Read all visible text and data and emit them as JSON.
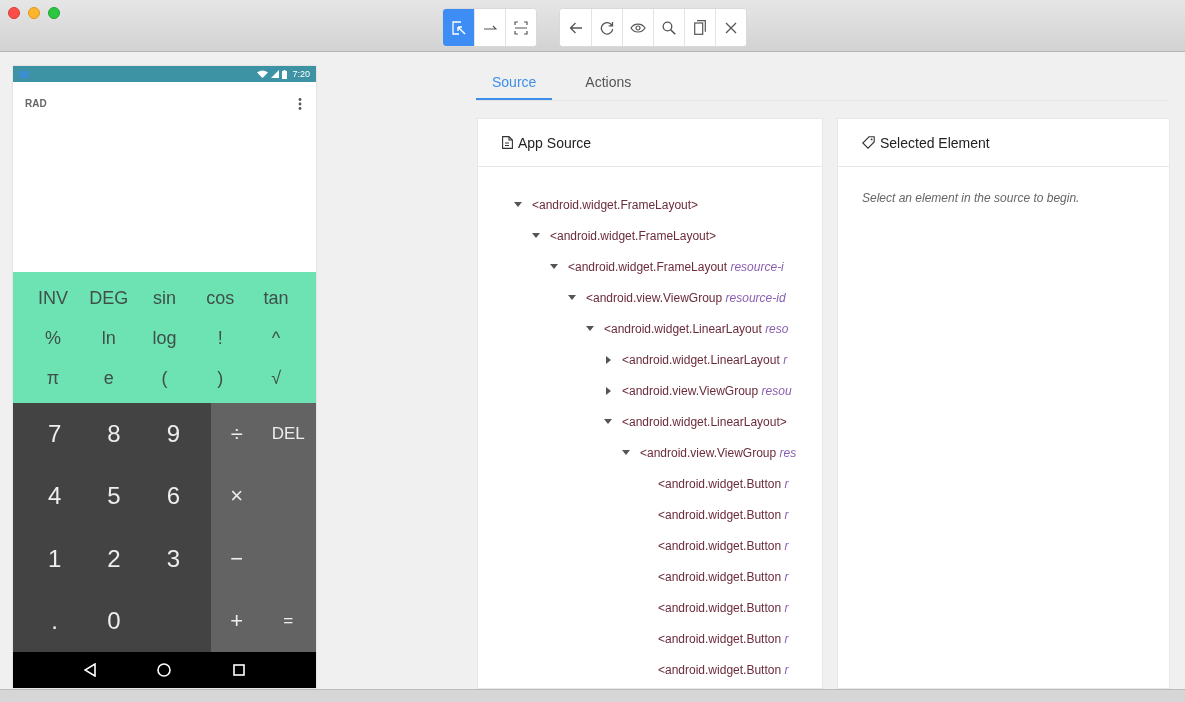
{
  "toolbar": {
    "modes": [
      {
        "kind": "select",
        "selected": true
      },
      {
        "kind": "swipe",
        "selected": false
      },
      {
        "kind": "tap-area",
        "selected": false
      }
    ],
    "actions": [
      {
        "kind": "back"
      },
      {
        "kind": "refresh"
      },
      {
        "kind": "eye"
      },
      {
        "kind": "search"
      },
      {
        "kind": "copy"
      },
      {
        "kind": "close"
      }
    ]
  },
  "device": {
    "status_bar": {
      "time": "7:20"
    },
    "display": {
      "mode": "RAD"
    },
    "advanced_keys": [
      [
        "INV",
        "DEG",
        "sin",
        "cos",
        "tan"
      ],
      [
        "%",
        "ln",
        "log",
        "!",
        "^"
      ],
      [
        "π",
        "e",
        "(",
        ")",
        "√"
      ]
    ],
    "digit_keys": [
      [
        "7",
        "8",
        "9"
      ],
      [
        "4",
        "5",
        "6"
      ],
      [
        "1",
        "2",
        "3"
      ],
      [
        ".",
        "0"
      ]
    ],
    "operator_keys": [
      [
        "÷",
        "DEL"
      ],
      [
        "×"
      ],
      [
        "−"
      ],
      [
        "+",
        "="
      ]
    ]
  },
  "tabs": [
    {
      "label": "Source",
      "selected": true
    },
    {
      "label": "Actions",
      "selected": false
    }
  ],
  "source_panel": {
    "title": "App Source",
    "tree": [
      {
        "tag": "<android.widget.FrameLayout>",
        "expanded": true,
        "children": [
          {
            "tag": "<android.widget.FrameLayout>",
            "expanded": true,
            "children": [
              {
                "tag": "<android.widget.FrameLayout",
                "attr": "resource-i",
                "expanded": true,
                "children": [
                  {
                    "tag": "<android.view.ViewGroup",
                    "attr": "resource-id",
                    "expanded": true,
                    "children": [
                      {
                        "tag": "<android.widget.LinearLayout",
                        "attr": "reso",
                        "expanded": true,
                        "children": [
                          {
                            "tag": "<android.widget.LinearLayout",
                            "attr": "r",
                            "expanded": false
                          },
                          {
                            "tag": "<android.view.ViewGroup",
                            "attr": "resou",
                            "expanded": false
                          },
                          {
                            "tag": "<android.widget.LinearLayout>",
                            "expanded": true,
                            "children": [
                              {
                                "tag": "<android.view.ViewGroup",
                                "attr": "res",
                                "expanded": true,
                                "children": [
                                  {
                                    "tag": "<android.widget.Button",
                                    "attr": "r"
                                  },
                                  {
                                    "tag": "<android.widget.Button",
                                    "attr": "r"
                                  },
                                  {
                                    "tag": "<android.widget.Button",
                                    "attr": "r"
                                  },
                                  {
                                    "tag": "<android.widget.Button",
                                    "attr": "r"
                                  },
                                  {
                                    "tag": "<android.widget.Button",
                                    "attr": "r"
                                  },
                                  {
                                    "tag": "<android.widget.Button",
                                    "attr": "r"
                                  },
                                  {
                                    "tag": "<android.widget.Button",
                                    "attr": "r"
                                  }
                                ]
                              }
                            ]
                          }
                        ]
                      }
                    ]
                  }
                ]
              }
            ]
          }
        ]
      }
    ]
  },
  "selected_panel": {
    "title": "Selected Element",
    "hint": "Select an element in the source to begin."
  }
}
